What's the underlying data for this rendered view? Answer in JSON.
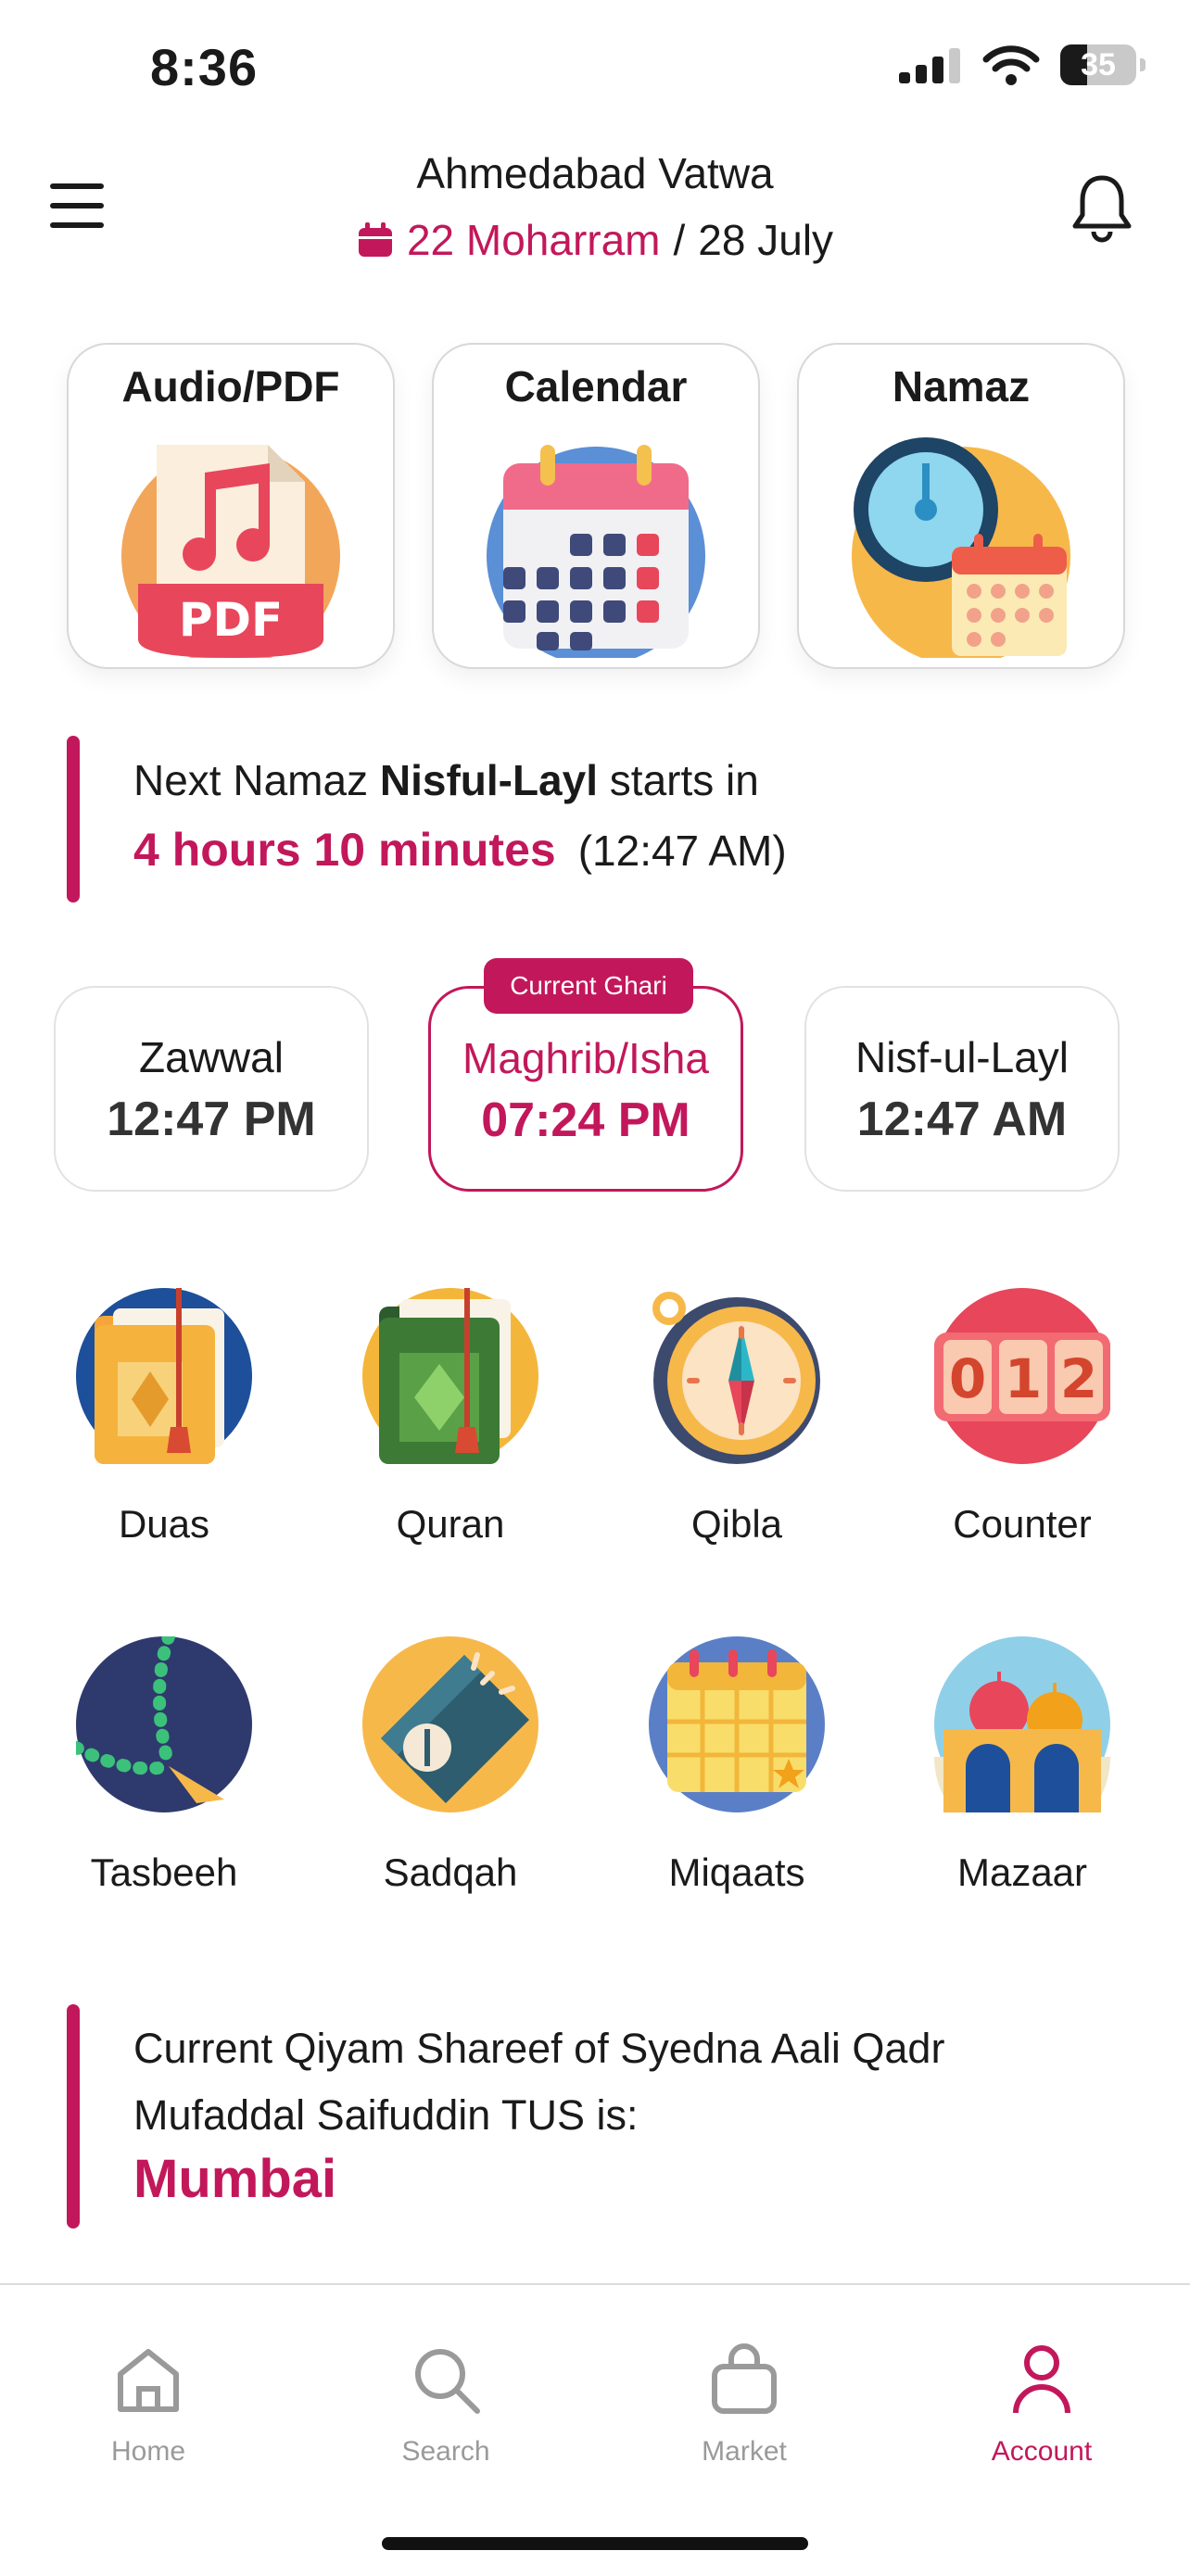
{
  "status_bar": {
    "time": "8:36",
    "battery": "35",
    "battery_level": 0.35
  },
  "header": {
    "title": "Ahmedabad Vatwa",
    "hijri_date": "22 Moharram",
    "separator": "/",
    "gregorian_date": "28 July",
    "icons": {
      "menu": "hamburger-icon",
      "calendar": "calendar-icon",
      "notification": "bell-icon"
    }
  },
  "quick_actions": [
    {
      "label": "Audio/PDF",
      "icon": "audio-pdf-icon"
    },
    {
      "label": "Calendar",
      "icon": "calendar-icon"
    },
    {
      "label": "Namaz",
      "icon": "clock-calendar-icon"
    }
  ],
  "next_namaz": {
    "prefix": "Next Namaz",
    "name": "Nisful-Layl",
    "suffix": "starts in",
    "countdown": "4 hours 10 minutes",
    "time": "(12:47 AM)"
  },
  "prayer_times": {
    "badge": "Current Ghari",
    "items": [
      {
        "name": "Zawwal",
        "time": "12:47 PM",
        "current": false
      },
      {
        "name": "Maghrib/Isha",
        "time": "07:24 PM",
        "current": true
      },
      {
        "name": "Nisf-ul-Layl",
        "time": "12:47 AM",
        "current": false
      }
    ]
  },
  "features": [
    {
      "label": "Duas",
      "icon": "dua-book-icon"
    },
    {
      "label": "Quran",
      "icon": "quran-icon"
    },
    {
      "label": "Qibla",
      "icon": "compass-icon"
    },
    {
      "label": "Counter",
      "icon": "counter-icon"
    },
    {
      "label": "Tasbeeh",
      "icon": "tasbeeh-icon"
    },
    {
      "label": "Sadqah",
      "icon": "sadqah-icon"
    },
    {
      "label": "Miqaats",
      "icon": "miqaat-calendar-icon"
    },
    {
      "label": "Mazaar",
      "icon": "mazaar-icon"
    }
  ],
  "qiyam": {
    "text": "Current Qiyam Shareef of Syedna Aali Qadr Mufaddal Saifuddin TUS is:",
    "city": "Mumbai"
  },
  "tab_bar": [
    {
      "label": "Home",
      "icon": "home-icon",
      "active": false
    },
    {
      "label": "Search",
      "icon": "search-icon",
      "active": false
    },
    {
      "label": "Market",
      "icon": "shopping-bag-icon",
      "active": false
    },
    {
      "label": "Account",
      "icon": "user-icon",
      "active": true
    }
  ],
  "colors": {
    "accent": "#c2185b",
    "text": "#1a1a1a",
    "inactive": "#9a9a9a"
  }
}
